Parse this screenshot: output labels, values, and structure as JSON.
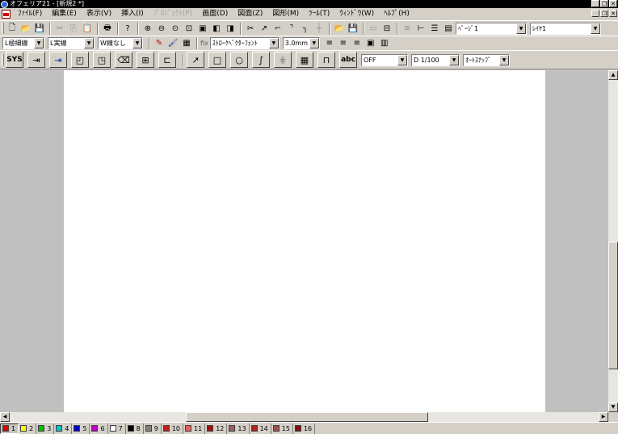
{
  "window": {
    "title": "オフェリア21 - [新規2 *]"
  },
  "menu": {
    "items": [
      {
        "label": "ﾌｧｲﾙ(F)",
        "enabled": true
      },
      {
        "label": "編集(E)",
        "enabled": true
      },
      {
        "label": "表示(V)",
        "enabled": true
      },
      {
        "label": "挿入(I)",
        "enabled": true
      },
      {
        "label": "ﾌﾟﾛｼﾞｪｸﾄ(P)",
        "enabled": false
      },
      {
        "label": "画面(D)",
        "enabled": true
      },
      {
        "label": "図面(Z)",
        "enabled": true
      },
      {
        "label": "図形(M)",
        "enabled": true
      },
      {
        "label": "ﾂｰﾙ(T)",
        "enabled": true
      },
      {
        "label": "ｳｨﾝﾄﾞｳ(W)",
        "enabled": true
      },
      {
        "label": "ﾍﾙﾌﾟ(H)",
        "enabled": true
      }
    ]
  },
  "toolbar1": {
    "page_combo": "ﾍﾟｰｼﾞ1",
    "layer_combo": "ﾚｲﾔ1"
  },
  "toolbar2": {
    "line_weight": "L極細線",
    "line_type": "L実線",
    "fill_type": "W線なし",
    "font_combo": "ｽﾄﾛｰｸﾍﾞｸﾀｰﾌｫﾝﾄ",
    "font_prefix": "fix",
    "size_combo": "3.0mm"
  },
  "toolbar3": {
    "sys_label": "SYS",
    "abc_label": "abc",
    "snap_off": "OFF",
    "scale": "D 1/100",
    "autosnap": "ｵｰﾄｽﾅｯﾌﾟ"
  },
  "colors": {
    "accent": "#2a6bd6",
    "workspace": "#c0c0c0",
    "page": "#ffffff"
  },
  "layers": [
    {
      "num": "1",
      "color": "#e00000",
      "active": true
    },
    {
      "num": "2",
      "color": "#ffff00"
    },
    {
      "num": "3",
      "color": "#00c000"
    },
    {
      "num": "4",
      "color": "#00c0c0"
    },
    {
      "num": "5",
      "color": "#0000c0"
    },
    {
      "num": "6",
      "color": "#c000c0"
    },
    {
      "num": "7",
      "color": "#ffffff"
    },
    {
      "num": "8",
      "color": "#000000"
    },
    {
      "num": "9",
      "color": "#808080"
    },
    {
      "num": "10",
      "color": "#c02020"
    },
    {
      "num": "11",
      "color": "#e06060"
    },
    {
      "num": "12",
      "color": "#a01010"
    },
    {
      "num": "13",
      "color": "#a06060"
    },
    {
      "num": "14",
      "color": "#b02020"
    },
    {
      "num": "15",
      "color": "#a05050"
    },
    {
      "num": "16",
      "color": "#801010"
    }
  ]
}
